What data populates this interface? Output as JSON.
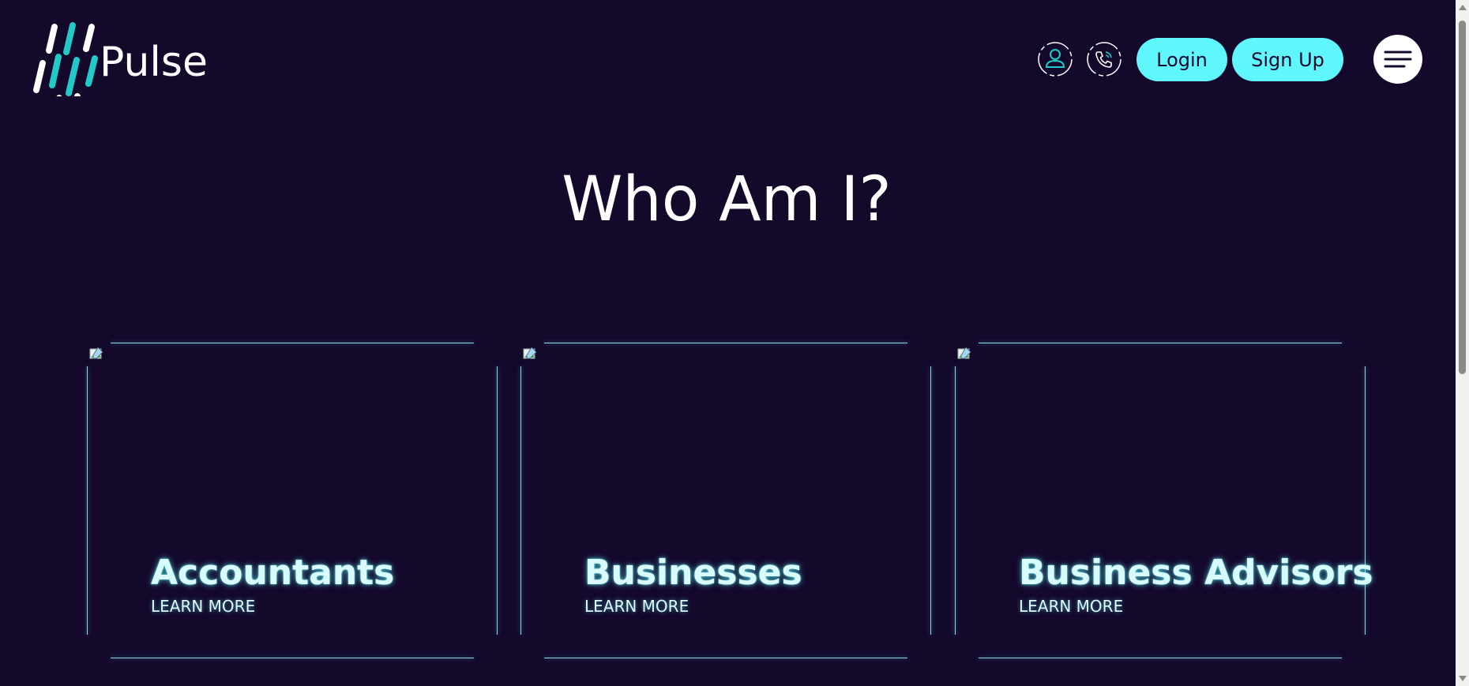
{
  "header": {
    "logo_text": "Pulse",
    "icons": [
      "user-icon",
      "phone-icon"
    ],
    "login_label": "Login",
    "signup_label": "Sign Up",
    "menu_icon": "hamburger-menu-icon"
  },
  "main": {
    "title": "Who Am I?",
    "cards": [
      {
        "title": "Accountants",
        "link_label": "LEARN MORE"
      },
      {
        "title": "Businesses",
        "link_label": "LEARN MORE"
      },
      {
        "title": "Business Advisors",
        "link_label": "LEARN MORE"
      }
    ]
  },
  "colors": {
    "background": "#14082b",
    "accent": "#5ff7fb",
    "card_text": "#d9fbfc",
    "white": "#ffffff"
  }
}
